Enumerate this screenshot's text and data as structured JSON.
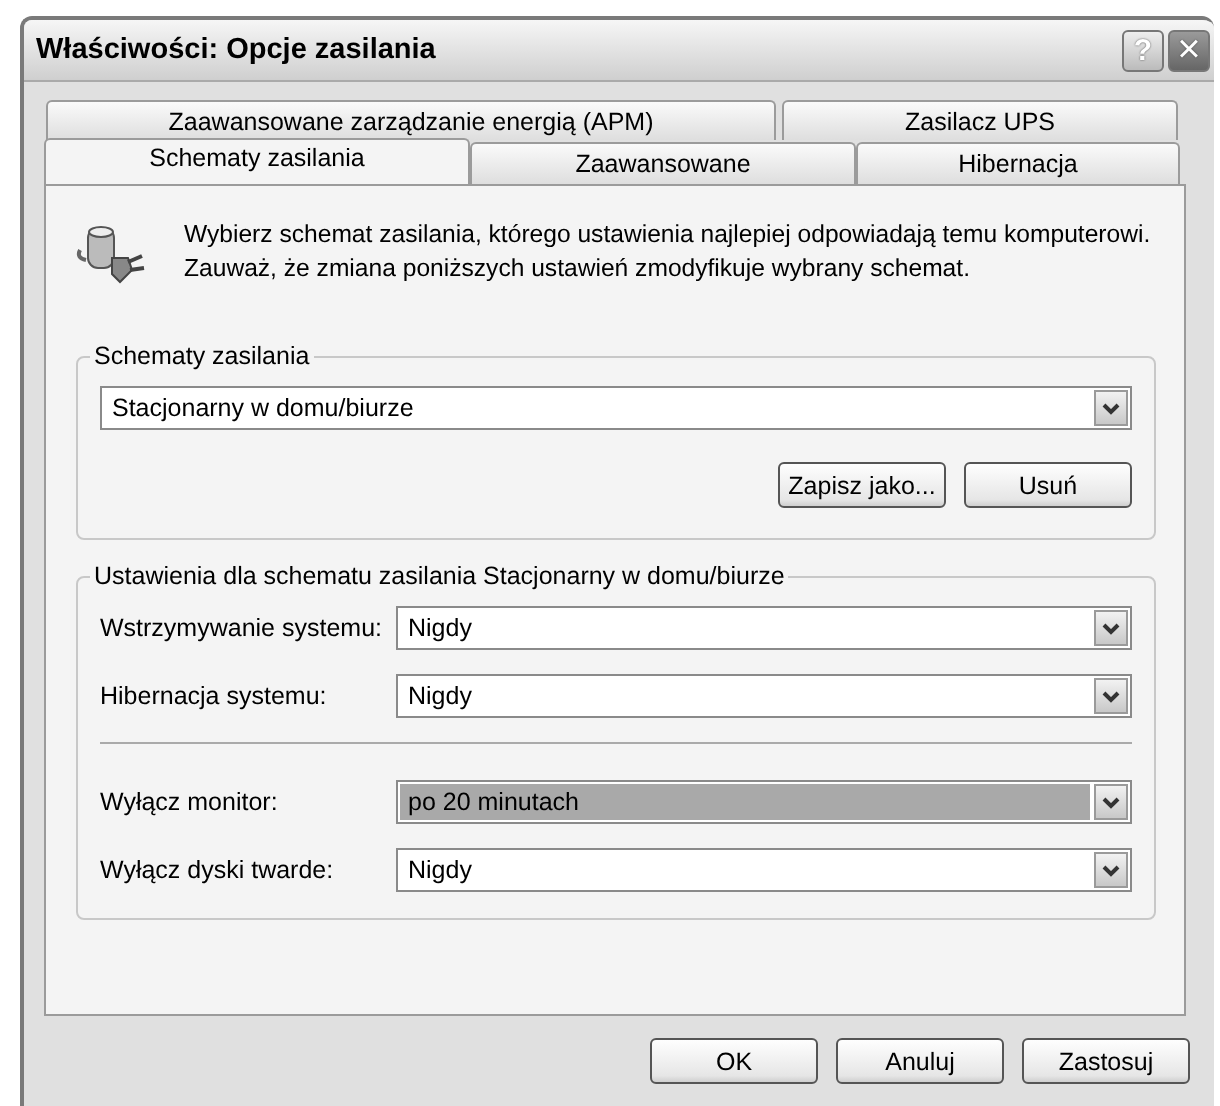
{
  "window": {
    "title": "Właściwości: Opcje zasilania",
    "help_button": "?",
    "close_button": "×"
  },
  "tab_rows": [
    [
      {
        "label": "Zaawansowane zarządzanie energią (APM)",
        "selected": false
      },
      {
        "label": "Zasilacz UPS",
        "selected": false
      }
    ],
    [
      {
        "label": "Schematy zasilania",
        "selected": true
      },
      {
        "label": "Zaawansowane",
        "selected": false
      },
      {
        "label": "Hibernacja",
        "selected": false
      }
    ]
  ],
  "intro": "Wybierz schemat zasilania, którego ustawienia najlepiej odpowiadają temu komputerowi. Zauważ, że zmiana poniższych ustawień zmodyfikuje wybrany schemat.",
  "schemes_group": {
    "title": "Schematy zasilania",
    "value": "Stacjonarny w domu/biurze",
    "buttons": [
      "Zapisz jako...",
      "Usuń"
    ]
  },
  "settings_group": {
    "title": "Ustawienia dla schematu zasilania Stacjonarny w domu/biurze",
    "rows": [
      {
        "label": "Wstrzymywanie systemu:",
        "value": "Nigdy",
        "highlighted": false,
        "separator_before": false
      },
      {
        "label": "Hibernacja systemu:",
        "value": "Nigdy",
        "highlighted": false,
        "separator_before": false
      },
      {
        "label": "Wyłącz monitor:",
        "value": "po 20 minutach",
        "highlighted": true,
        "separator_before": true
      },
      {
        "label": "Wyłącz dyski twarde:",
        "value": "Nigdy",
        "highlighted": false,
        "separator_before": false
      }
    ]
  },
  "buttons": [
    "OK",
    "Anuluj",
    "Zastosuj"
  ]
}
